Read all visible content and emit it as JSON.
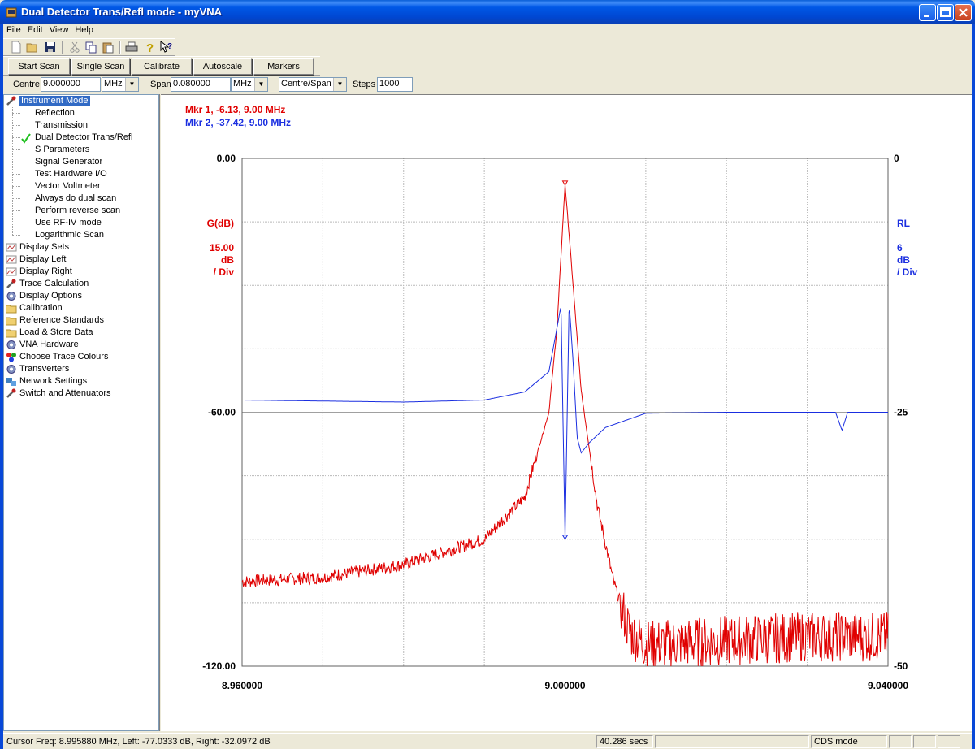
{
  "window": {
    "title": "Dual Detector Trans/Refl mode - myVNA"
  },
  "menu": [
    "File",
    "Edit",
    "View",
    "Help"
  ],
  "toolbar_icons": [
    "new-icon",
    "open-icon",
    "save-icon",
    "cut-icon",
    "copy-icon",
    "paste-icon",
    "print-icon",
    "help-icon",
    "context-help-icon"
  ],
  "buttons": {
    "start_scan": "Start Scan",
    "single_scan": "Single Scan",
    "calibrate": "Calibrate",
    "autoscale": "Autoscale",
    "markers": "Markers"
  },
  "freq": {
    "centre_label": "Centre",
    "centre_value": "9.000000",
    "centre_unit": "MHz",
    "span_label": "Span",
    "span_value": "0.080000",
    "span_unit": "MHz",
    "mode": "Centre/Span",
    "steps_label": "Steps",
    "steps_value": "1000"
  },
  "tree": {
    "root": "Instrument Mode",
    "children": [
      "Reflection",
      "Transmission",
      "Dual Detector Trans/Refl",
      "S Parameters",
      "Signal Generator",
      "Test Hardware I/O",
      "Vector Voltmeter",
      "Always do dual scan",
      "Perform reverse scan",
      "Use RF-IV mode",
      "Logarithmic Scan"
    ],
    "checked_child": "Dual Detector Trans/Refl",
    "top_items": [
      {
        "label": "Display Sets",
        "icon": "display-icon"
      },
      {
        "label": "Display Left",
        "icon": "display-icon"
      },
      {
        "label": "Display Right",
        "icon": "display-icon"
      },
      {
        "label": "Trace Calculation",
        "icon": "wrench-icon"
      },
      {
        "label": "Display Options",
        "icon": "gear-icon"
      },
      {
        "label": "Calibration",
        "icon": "folder-icon"
      },
      {
        "label": "Reference Standards",
        "icon": "folder-icon"
      },
      {
        "label": "Load & Store Data",
        "icon": "folder-icon"
      },
      {
        "label": "VNA Hardware",
        "icon": "gear-icon"
      },
      {
        "label": "Choose Trace Colours",
        "icon": "colour-dots-icon"
      },
      {
        "label": "Transverters",
        "icon": "gear-icon"
      },
      {
        "label": "Network Settings",
        "icon": "network-icon"
      },
      {
        "label": "Switch and Attenuators",
        "icon": "wrench-icon"
      }
    ]
  },
  "plot": {
    "marker1": "Mkr 1, -6.13, 9.00 MHz",
    "marker2": "Mkr 2, -37.42, 9.00 MHz",
    "left_axis": {
      "title": "G(dB)",
      "scale_value": "15.00",
      "scale_unit": "dB",
      "scale_per": "/ Div",
      "top": "0.00",
      "mid": "-60.00",
      "bottom": "-120.00"
    },
    "right_axis": {
      "title": "RL",
      "scale_value": "6",
      "scale_unit": "dB",
      "scale_per": "/ Div",
      "top": "0",
      "mid": "-25",
      "bottom": "-50"
    },
    "x_labels": [
      "8.960000",
      "9.000000",
      "9.040000"
    ],
    "colors": {
      "trace_left": "#e00000",
      "trace_right": "#1a2ee0",
      "grid": "#b8b8b8"
    }
  },
  "chart_data": {
    "type": "line",
    "x_unit": "MHz",
    "xlim": [
      8.96,
      9.04
    ],
    "series": [
      {
        "axis": "left",
        "ylim": [
          -120,
          0
        ],
        "x": [
          8.96,
          8.97,
          8.98,
          8.99,
          8.995,
          8.998,
          8.999,
          9.0,
          9.001,
          9.002,
          9.004,
          9.006,
          9.008,
          9.01,
          9.02,
          9.03,
          9.04
        ],
        "y": [
          -100,
          -99,
          -96,
          -90,
          -80,
          -60,
          -40,
          -6.13,
          -30,
          -55,
          -82,
          -100,
          -112,
          -115,
          -114,
          -113,
          -113
        ]
      },
      {
        "axis": "right",
        "ylim": [
          -50,
          0
        ],
        "x": [
          8.96,
          8.97,
          8.98,
          8.99,
          8.995,
          8.998,
          8.9995,
          9.0,
          9.0005,
          9.001,
          9.0015,
          9.002,
          9.003,
          9.005,
          9.01,
          9.02,
          9.0335,
          9.0343,
          9.035,
          9.04
        ],
        "y": [
          -23.8,
          -23.9,
          -24.0,
          -23.8,
          -23.0,
          -21.0,
          -14.5,
          -37.42,
          -14.2,
          -20.0,
          -27.5,
          -29.0,
          -28.0,
          -26.5,
          -25.1,
          -25.0,
          -25.0,
          -26.8,
          -25.0,
          -25.0
        ]
      }
    ]
  },
  "status": {
    "cursor": "Cursor Freq: 8.995880 MHz, Left: -77.0333 dB, Right: -32.0972 dB",
    "time": "40.286 secs",
    "mode": "CDS mode"
  }
}
